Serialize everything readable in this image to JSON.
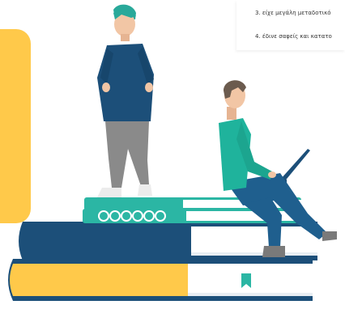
{
  "document": {
    "items": [
      {
        "text": "3. είχε μεγάλη μεταδοτικό"
      },
      {
        "text": "4. έδινε σαφείς και κατατο"
      }
    ]
  },
  "colors": {
    "accent_yellow": "#ffc94a",
    "book_navy": "#1c4f79",
    "book_teal": "#2bb6a4",
    "shirt_teal": "#1fb39c",
    "pants_blue": "#1f5f8e",
    "pants_gray": "#8a8a8a",
    "hair_teal": "#29a99a",
    "hair_brown": "#6b5b4e",
    "skin": "#f2c6a5"
  },
  "icons": [
    "bookmark-icon"
  ]
}
